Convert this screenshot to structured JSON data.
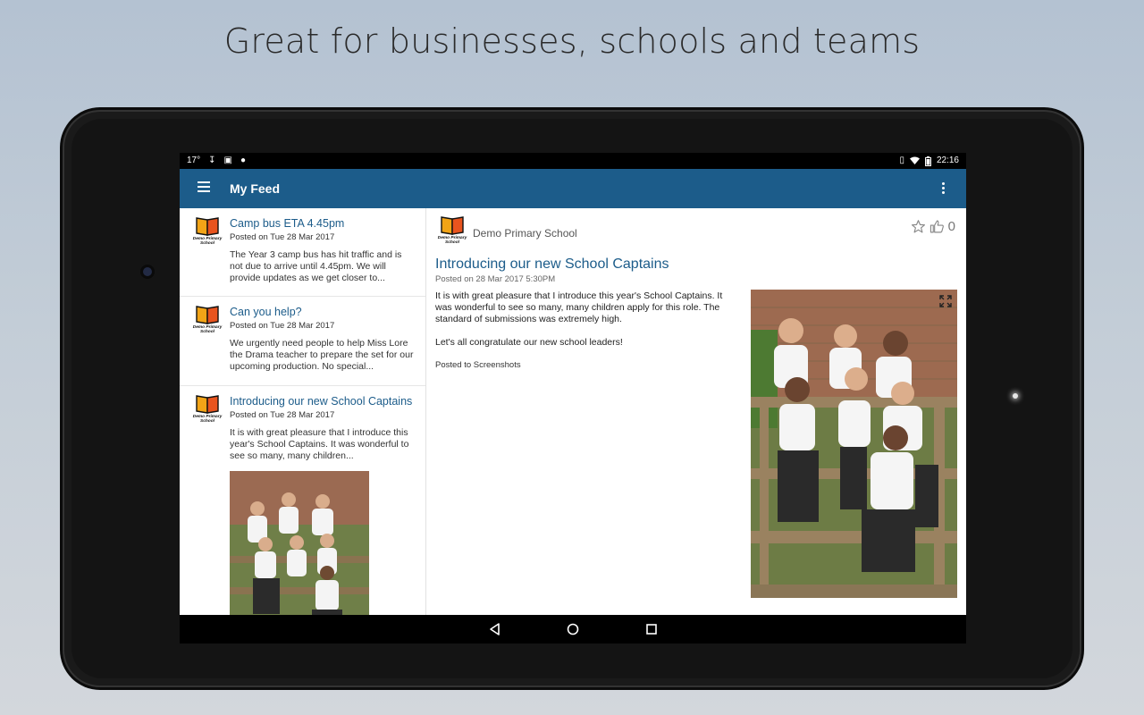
{
  "headline": "Great for businesses, schools and teams",
  "status": {
    "temperature": "17°",
    "time": "22:16"
  },
  "appbar": {
    "title": "My Feed"
  },
  "school": {
    "name": "Demo Primary School",
    "logo_text": "Demo Primary School"
  },
  "feed": {
    "items": [
      {
        "title": "Camp bus ETA 4.45pm",
        "date": "Posted on Tue 28 Mar 2017",
        "excerpt": "The Year 3 camp bus has hit traffic and is not due to arrive until 4.45pm. We will provide updates as we get closer to..."
      },
      {
        "title": "Can you help?",
        "date": "Posted on Tue 28 Mar 2017",
        "excerpt": "We urgently need people to help Miss Lore the Drama teacher to prepare the set for our upcoming production. No special..."
      },
      {
        "title": "Introducing our new School Captains",
        "date": "Posted on Tue 28 Mar 2017",
        "excerpt": "It is with great pleasure that I introduce this year's School Captains. It was wonderful to see so many, many children..."
      }
    ]
  },
  "detail": {
    "school": "Demo Primary School",
    "likes": "0",
    "title": "Introducing our new School Captains",
    "date": "Posted on 28 Mar 2017 5:30PM",
    "paragraph1": "It is with great pleasure that I introduce this year's School Captains. It was wonderful to see so many, many children apply for this role. The standard of submissions was extremely high.",
    "paragraph2": "Let's all congratulate our new school leaders!",
    "posted_to": "Posted to Screenshots"
  },
  "icons": {
    "menu": "hamburger-menu-icon",
    "overflow": "more-vert-icon",
    "star": "star-outline-icon",
    "like": "thumbs-up-icon",
    "expand": "fullscreen-icon",
    "back": "nav-back-icon",
    "home": "nav-home-icon",
    "recents": "nav-recents-icon"
  },
  "colors": {
    "appbar": "#1c5c8a",
    "link": "#1c5c8a"
  }
}
